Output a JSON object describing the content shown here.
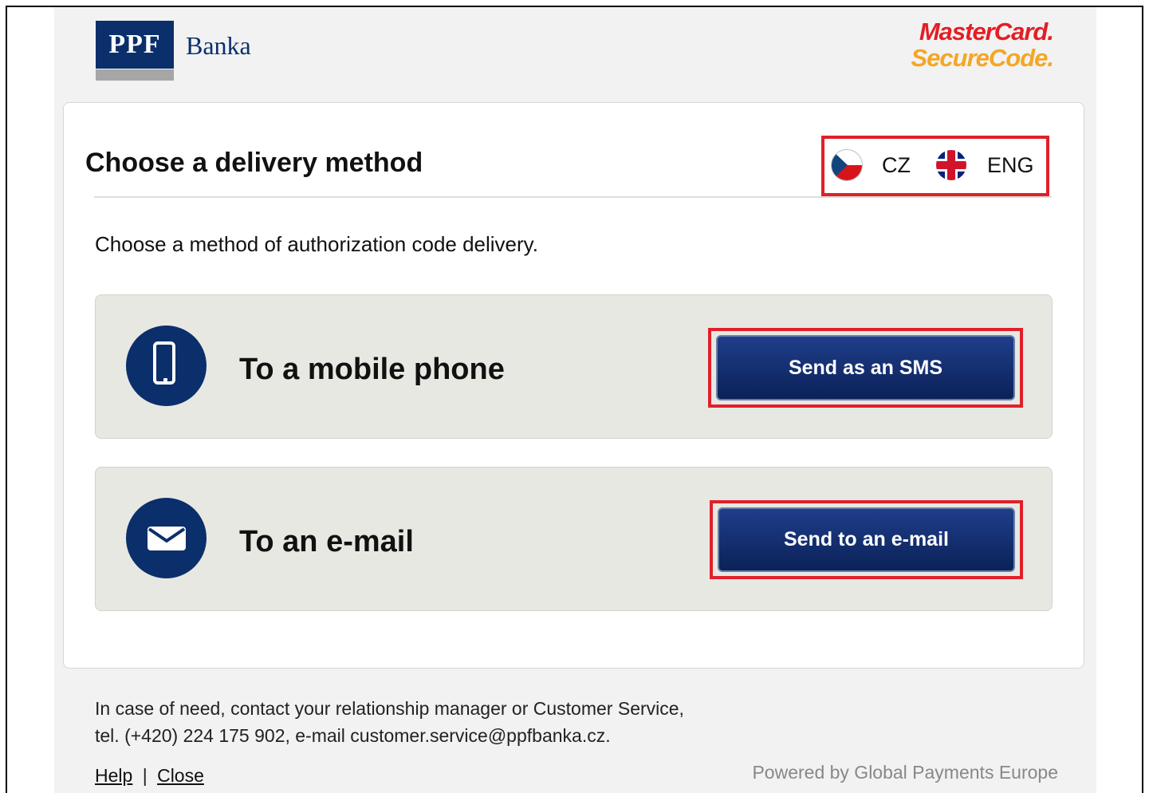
{
  "header": {
    "logo_mark": "PPF",
    "logo_name": "Banka",
    "badge_line1": "MasterCard.",
    "badge_line2": "SecureCode."
  },
  "card": {
    "title": "Choose a delivery method",
    "intro": "Choose a method of authorization code delivery.",
    "languages": [
      {
        "code": "CZ",
        "flag": "czech-flag-icon"
      },
      {
        "code": "ENG",
        "flag": "uk-flag-icon"
      }
    ],
    "options": [
      {
        "label": "To a mobile phone",
        "icon": "mobile-phone-icon",
        "button": "Send as an SMS"
      },
      {
        "label": "To an e-mail",
        "icon": "envelope-icon",
        "button": "Send to an e-mail"
      }
    ]
  },
  "footer": {
    "contact_line1": "In case of need, contact your relationship manager or Customer Service,",
    "contact_line2": "tel. (+420) 224 175 902, e-mail customer.service@ppfbanka.cz.",
    "help": "Help",
    "separator": "|",
    "close": "Close",
    "powered_by": "Powered by Global Payments Europe"
  },
  "colors": {
    "brand_navy": "#0b2f6b",
    "highlight_red": "#e0202a",
    "panel_bg": "#e8e8e3"
  }
}
